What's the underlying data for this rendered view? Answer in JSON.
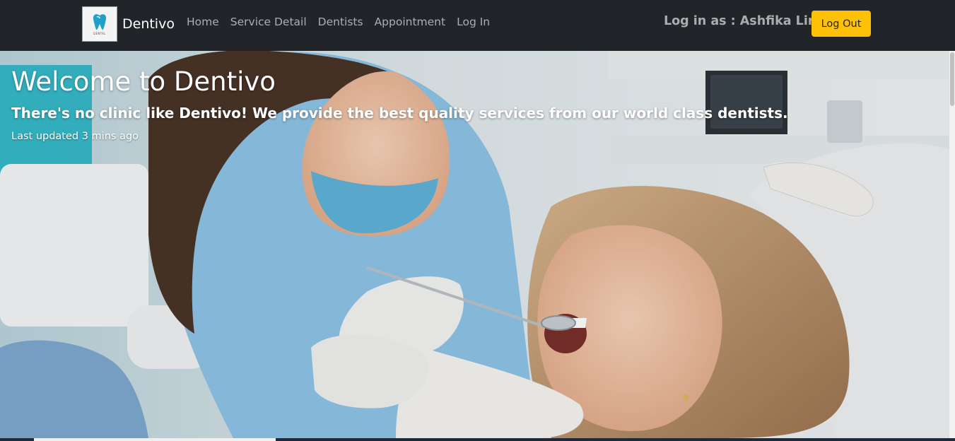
{
  "navbar": {
    "brand_name": "Dentivo",
    "logo_caption": "DENTAL",
    "links": [
      "Home",
      "Service Detail",
      "Dentists",
      "Appointment",
      "Log In"
    ],
    "user_label": "Log in as : Ashfika Lira",
    "logout_label": "Log Out"
  },
  "hero": {
    "title": "Welcome to Dentivo",
    "subtitle": "There's no clinic like Dentivo! We provide the best quality services from our world class dentists.",
    "updated": "Last updated 3 mins ago"
  },
  "colors": {
    "navbar_bg": "#212529",
    "accent_button": "#ffc107",
    "logo_tooth": "#1ea0c9"
  },
  "icons": {
    "logo": "tooth-logo-icon"
  }
}
